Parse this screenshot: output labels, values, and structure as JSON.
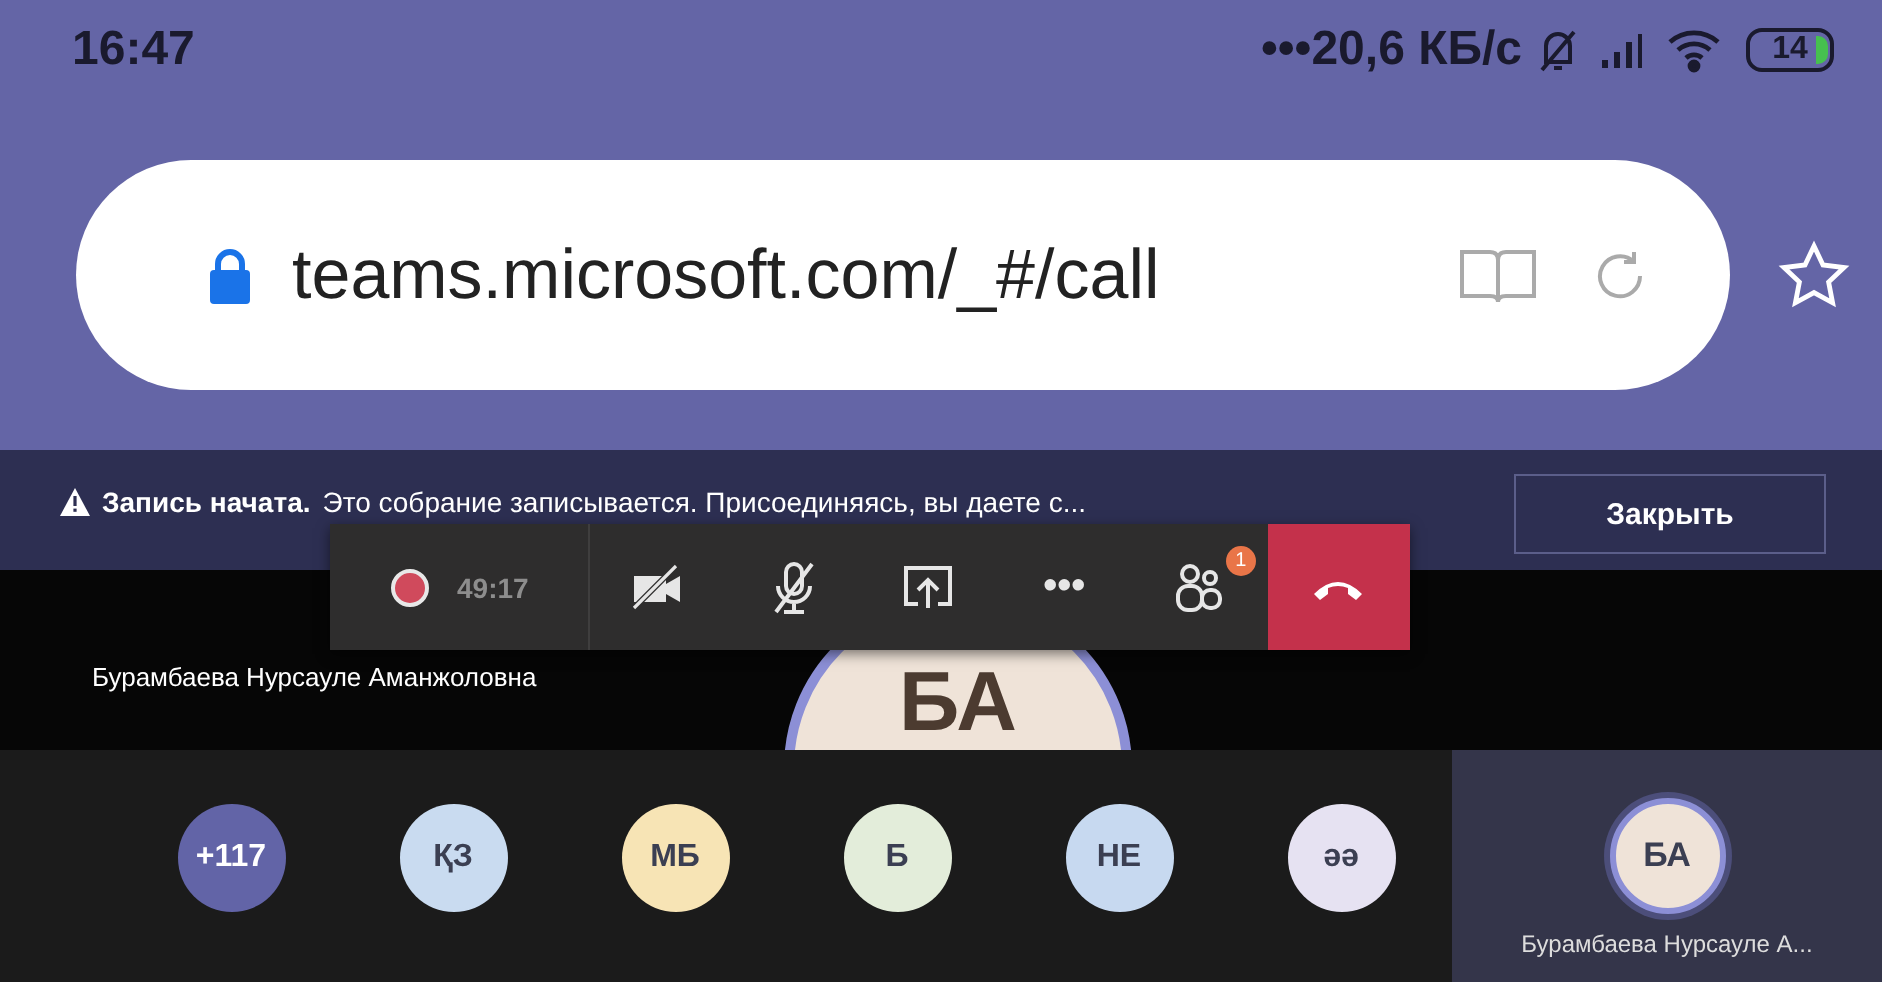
{
  "status_bar": {
    "time": "16:47",
    "network": "•••20,6 КБ/с",
    "battery": "14"
  },
  "address_bar": {
    "url": "teams.microsoft.com/_#/call"
  },
  "banner": {
    "title": "Запись начата.",
    "message": "Это собрание записывается. Присоединяясь, вы даете с...",
    "button": "Закрыть"
  },
  "call_toolbar": {
    "timer": "49:17",
    "more": "•••",
    "participants_badge": "1"
  },
  "stage": {
    "name": "Бурамбаева Нурсауле Аманжоловна",
    "initials": "БА"
  },
  "participants": [
    {
      "kind": "overflow",
      "label": "+117",
      "color": "#6264a7"
    },
    {
      "kind": "person",
      "label": "ҚЗ",
      "color": "#c9dbf0"
    },
    {
      "kind": "person",
      "label": "МБ",
      "color": "#f7e4b5"
    },
    {
      "kind": "person",
      "label": "Б",
      "color": "#e3edda"
    },
    {
      "kind": "person",
      "label": "НЕ",
      "color": "#c7d9f0"
    },
    {
      "kind": "person",
      "label": "əə",
      "color": "#e6e2f2"
    }
  ],
  "self_tile": {
    "initials": "БА",
    "name": "Бурамбаева Нурсауле А..."
  }
}
